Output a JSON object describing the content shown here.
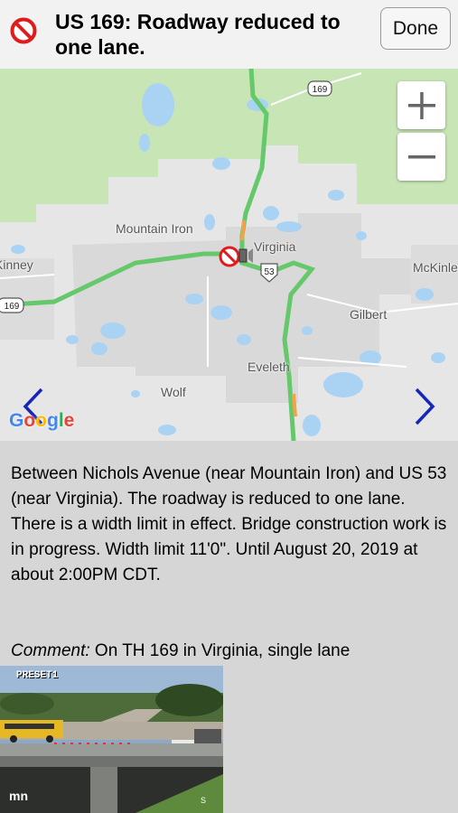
{
  "header": {
    "title": "US 169: Roadway reduced to one lane.",
    "done_label": "Done"
  },
  "map": {
    "labels": {
      "mountain_iron": "Mountain Iron",
      "virginia": "Virginia",
      "kinney": "Kinney",
      "mckinley": "McKinle",
      "gilbert": "Gilbert",
      "eveleth": "Eveleth",
      "wolf": "Wolf"
    },
    "shields": {
      "us169_top": "169",
      "us169_left": "169",
      "us53": "53"
    },
    "zoom_in": "+",
    "zoom_out": "−",
    "attribution": "Google",
    "colors": {
      "forest": "#c7e6b3",
      "urban": "#dcdcdc",
      "water": "#a8d1f2",
      "road_traffic": "#6fcf70"
    }
  },
  "description": "Between Nichols Avenue (near Mountain Iron) and US 53 (near Virginia). The roadway is reduced to one lane. There is a width limit in effect. Bridge construction work is in progress. Width limit 11'0\". Until August 20, 2019 at about 2:00PM CDT.",
  "comment": {
    "label": "Comment:",
    "text": "On TH 169 in Virginia, single lane"
  },
  "camera": {
    "preset_label": "PRESET1",
    "corner_label": "S",
    "logo_text": "mn"
  }
}
